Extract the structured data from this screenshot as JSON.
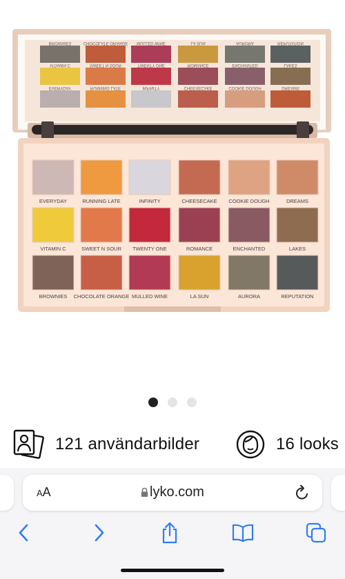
{
  "product": {
    "palette_main_rows": [
      [
        {
          "name": "EVERYDAY",
          "color": "#cdb8b6"
        },
        {
          "name": "RUNNING LATE",
          "color": "#ef9a40"
        },
        {
          "name": "INFINITY",
          "color": "#d9d7dd"
        },
        {
          "name": "CHEESECAKE",
          "color": "#c46a53"
        },
        {
          "name": "COOKIE DOUGH",
          "color": "#dea382"
        },
        {
          "name": "DREAMS",
          "color": "#cf8b68"
        }
      ],
      [
        {
          "name": "VITAMIN C",
          "color": "#efcb3c"
        },
        {
          "name": "SWEET N SOUR",
          "color": "#e2794a"
        },
        {
          "name": "TWENTY ONE",
          "color": "#c3283c"
        },
        {
          "name": "ROMANCE",
          "color": "#9b4052"
        },
        {
          "name": "ENCHANTED",
          "color": "#8a5a63"
        },
        {
          "name": "LAKES",
          "color": "#8e6c50"
        }
      ],
      [
        {
          "name": "BROWNIES",
          "color": "#7f6359"
        },
        {
          "name": "CHOCOLATE ORANGE",
          "color": "#c65f46"
        },
        {
          "name": "MULLED WINE",
          "color": "#b23a54"
        },
        {
          "name": "LA SUN",
          "color": "#d9a22e"
        },
        {
          "name": "AURORA",
          "color": "#827867"
        },
        {
          "name": "REPUTATION",
          "color": "#565a5b"
        }
      ]
    ],
    "mirror_rows": [
      [
        {
          "name": "BROWNIES",
          "color": "#6c6862"
        },
        {
          "name": "CHOCOLATE ORANGE",
          "color": "#b9502e"
        },
        {
          "name": "MULLED WINE",
          "color": "#a52f4d"
        },
        {
          "name": "LA SUN",
          "color": "#c49232"
        },
        {
          "name": "AURORA",
          "color": "#6a6f66"
        },
        {
          "name": "REPUTATION",
          "color": "#4d5557"
        }
      ],
      [
        {
          "name": "VITAMIN C",
          "color": "#e8c234"
        },
        {
          "name": "SWEET N SOUR",
          "color": "#d7713b"
        },
        {
          "name": "TWENTY ONE",
          "color": "#b72a3e"
        },
        {
          "name": "ROMANCE",
          "color": "#93404e"
        },
        {
          "name": "ENCHANTED",
          "color": "#7f5560"
        },
        {
          "name": "LAKES",
          "color": "#7c6446"
        }
      ],
      [
        {
          "name": "EVERYDAY",
          "color": "#b5a9ab"
        },
        {
          "name": "RUNNING LATE",
          "color": "#e48a34"
        },
        {
          "name": "INFINITY",
          "color": "#c2c4cb"
        },
        {
          "name": "CHEESECAKE",
          "color": "#b5533f"
        },
        {
          "name": "COOKIE DOUGH",
          "color": "#d29777"
        },
        {
          "name": "DREAMS",
          "color": "#b8502b"
        }
      ]
    ],
    "case_color": "#f4d9c8",
    "tray_color": "#fbe6d8"
  },
  "carousel": {
    "current": 1,
    "total": 3
  },
  "stats": {
    "user_images": "121 användarbilder",
    "looks": "16 looks"
  },
  "browser": {
    "text_size_label_small": "A",
    "text_size_label_large": "A",
    "url": "lyko.com"
  },
  "colors": {
    "link_blue": "#2f7cf6"
  }
}
